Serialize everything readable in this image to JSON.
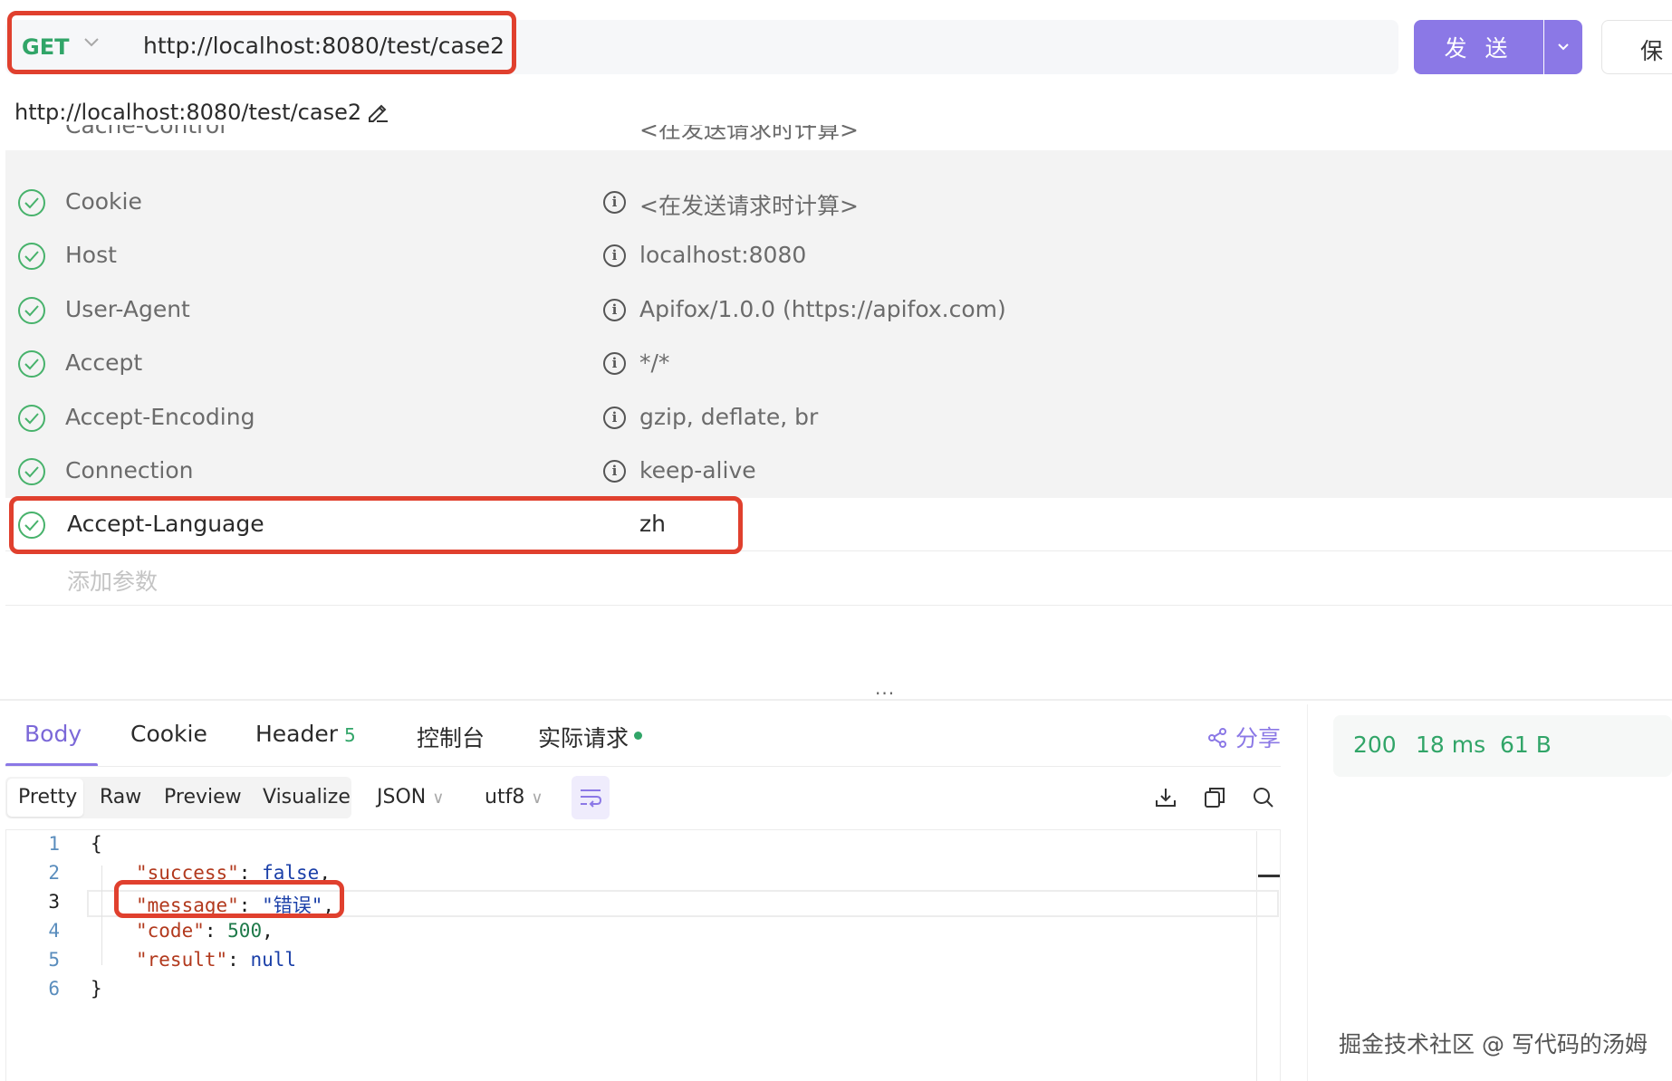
{
  "request": {
    "method": "GET",
    "url": "http://localhost:8080/test/case2",
    "send_label": "发 送",
    "save_label": "保",
    "url_display": "http://localhost:8080/test/case2"
  },
  "headers": {
    "cut_off_row": {
      "key": "Cache-Control",
      "value": "<在发送请求时计算>"
    },
    "rows": [
      {
        "key": "Cookie",
        "value": "<在发送请求时计算>"
      },
      {
        "key": "Host",
        "value": "localhost:8080"
      },
      {
        "key": "User-Agent",
        "value": "Apifox/1.0.0 (https://apifox.com)"
      },
      {
        "key": "Accept",
        "value": "*/*"
      },
      {
        "key": "Accept-Encoding",
        "value": "gzip, deflate, br"
      },
      {
        "key": "Connection",
        "value": "keep-alive"
      }
    ],
    "custom_row": {
      "key": "Accept-Language",
      "value": "zh"
    },
    "add_placeholder": "添加参数"
  },
  "response": {
    "tabs": {
      "body": "Body",
      "cookie": "Cookie",
      "header": "Header",
      "header_count": "5",
      "console": "控制台",
      "actual_request": "实际请求"
    },
    "share_label": "分享",
    "view_modes": {
      "pretty": "Pretty",
      "raw": "Raw",
      "preview": "Preview",
      "visualize": "Visualize"
    },
    "format": "JSON",
    "encoding": "utf8",
    "code": {
      "line_numbers": [
        "1",
        "2",
        "3",
        "4",
        "5",
        "6"
      ],
      "open_brace": "{",
      "close_brace": "}",
      "success_key": "\"success\"",
      "success_val": "false",
      "message_key": "\"message\"",
      "message_val": "\"错误\"",
      "code_key": "\"code\"",
      "code_val": "500",
      "result_key": "\"result\"",
      "result_val": "null"
    },
    "status": {
      "code": "200",
      "time": "18 ms",
      "size": "61 B"
    }
  },
  "watermark": "掘金技术社区 @ 写代码的汤姆",
  "colors": {
    "accent": "#8b78e6",
    "success_green": "#31a568",
    "annotation_red": "#e0402e"
  }
}
